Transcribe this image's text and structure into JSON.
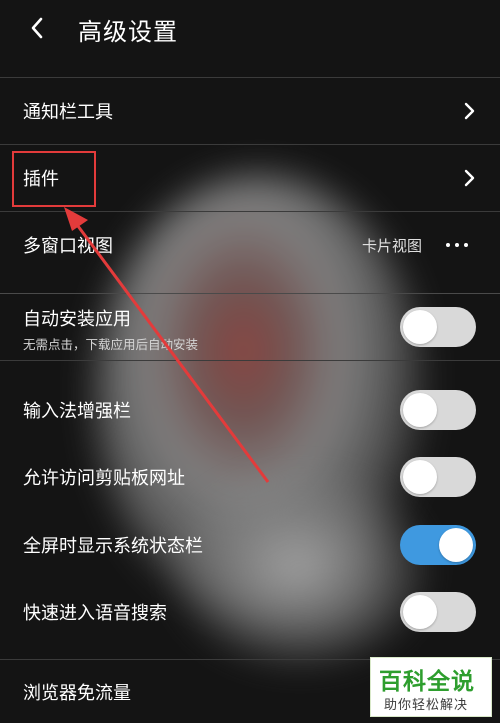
{
  "header": {
    "title": "高级设置"
  },
  "rows": {
    "notification": {
      "label": "通知栏工具"
    },
    "plugins": {
      "label": "插件"
    },
    "multiwindow": {
      "label": "多窗口视图",
      "value": "卡片视图"
    },
    "autoinstall": {
      "label": "自动安装应用",
      "sub": "无需点击，下载应用后自动安装",
      "on": false
    },
    "imeenhance": {
      "label": "输入法增强栏",
      "on": false
    },
    "clipboard": {
      "label": "允许访问剪贴板网址",
      "on": false
    },
    "statusbar": {
      "label": "全屏时显示系统状态栏",
      "on": true
    },
    "voice": {
      "label": "快速进入语音搜索",
      "on": false
    },
    "freedata": {
      "label": "浏览器免流量"
    }
  },
  "watermark": {
    "title": "百科全说",
    "subtitle": "助你轻松解决"
  },
  "colors": {
    "toggle_on": "#3f99e0",
    "toggle_off": "#d9d9d9",
    "highlight": "#e33b3b",
    "background": "#141414"
  }
}
